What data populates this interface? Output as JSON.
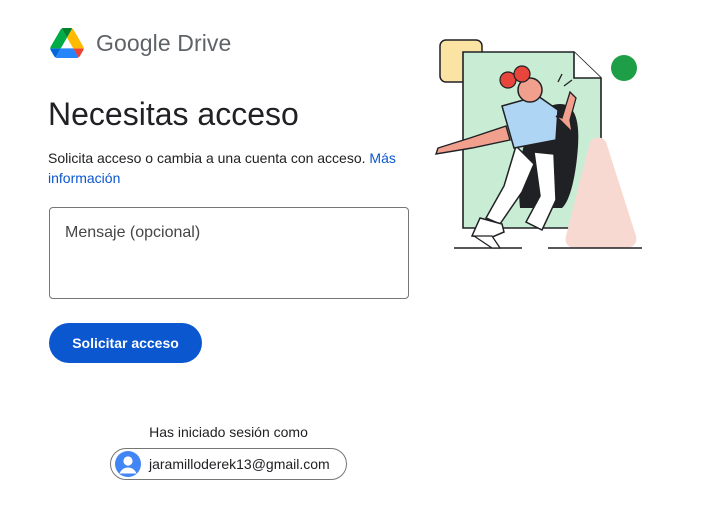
{
  "app": {
    "name": "Google Drive",
    "logo_icon": "google-drive-logo"
  },
  "main": {
    "title": "Necesitas acceso",
    "description": "Solicita acceso o cambia a una cuenta con acceso.",
    "learn_more_link": "Más información",
    "message_placeholder": "Mensaje (opcional)",
    "message_value": "",
    "request_button": "Solicitar acceso"
  },
  "account": {
    "signed_in_label": "Has iniciado sesión como",
    "email": "jaramilloderek13@gmail.com",
    "avatar_icon": "person-avatar-icon"
  },
  "colors": {
    "primary": "#0b57d0",
    "text": "#202124",
    "illustration_green": "#c8ecd4",
    "illustration_dot": "#1e9e47",
    "illustration_pink": "#f8d9d2",
    "illustration_yellow": "#fbe3a4",
    "illustration_red": "#e8453c",
    "illustration_blue": "#aed6f4"
  }
}
